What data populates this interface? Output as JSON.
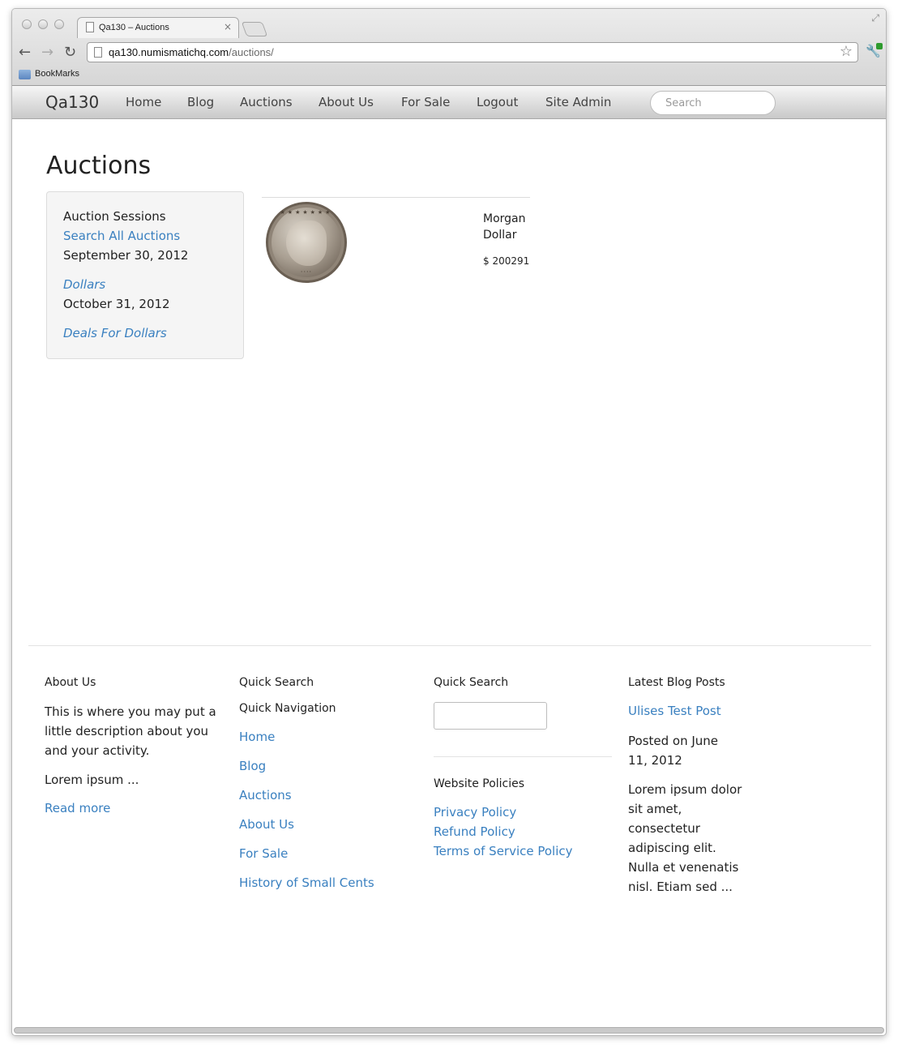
{
  "browser": {
    "tab_title": "Qa130 – Auctions",
    "tab_close": "×",
    "url_host": "qa130.numismatichq.com",
    "url_path": "/auctions/",
    "bookmarks_label": "BookMarks",
    "icons": {
      "back": "back-arrow-icon",
      "forward": "forward-arrow-icon",
      "reload": "reload-icon",
      "star": "bookmark-star-icon",
      "wrench": "wrench-icon",
      "folder": "folder-icon"
    }
  },
  "navbar": {
    "brand": "Qa130",
    "items": [
      "Home",
      "Blog",
      "Auctions",
      "About Us",
      "For Sale",
      "Logout",
      "Site Admin"
    ],
    "search_placeholder": "Search"
  },
  "main": {
    "title": "Auctions",
    "sidebar": {
      "heading": "Auction Sessions",
      "search_all": "Search All Auctions",
      "sessions": [
        {
          "date": "September 30, 2012",
          "name": "Dollars"
        },
        {
          "date": "October 31, 2012",
          "name": "Deals For Dollars"
        }
      ]
    },
    "items": [
      {
        "name": "Morgan Dollar",
        "price": "$ 200291"
      }
    ]
  },
  "footer": {
    "about": {
      "heading": "About Us",
      "description": "This is where you may put a little description about you and your activity.",
      "lorem": "Lorem ipsum ...",
      "read_more": "Read more"
    },
    "nav": {
      "heading": "Quick Search",
      "subheading": "Quick Navigation",
      "links": [
        "Home",
        "Blog",
        "Auctions",
        "About Us",
        "For Sale",
        "History of Small Cents"
      ]
    },
    "search": {
      "heading": "Quick Search",
      "policies_heading": "Website Policies",
      "policies": [
        "Privacy Policy",
        "Refund Policy",
        "Terms of Service Policy"
      ]
    },
    "blog": {
      "heading": "Latest Blog Posts",
      "post_title": "Ulises Test Post",
      "posted": "Posted on June 11, 2012",
      "excerpt": "Lorem ipsum dolor sit amet, consectetur adipiscing elit. Nulla et venenatis nisl. Etiam sed ..."
    }
  },
  "colors": {
    "link": "#3a80c0",
    "text": "#222222"
  }
}
